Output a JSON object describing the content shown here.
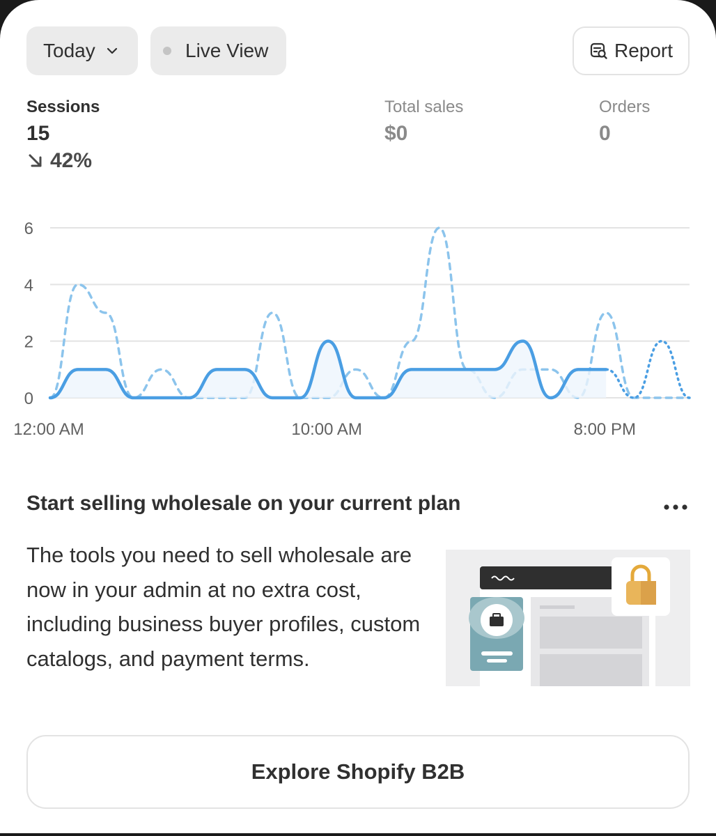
{
  "toolbar": {
    "date_filter_label": "Today",
    "live_view_label": "Live View",
    "report_label": "Report"
  },
  "metrics": {
    "sessions": {
      "label": "Sessions",
      "value": "15",
      "change": "42%"
    },
    "total_sales": {
      "label": "Total sales",
      "value": "$0"
    },
    "orders": {
      "label": "Orders",
      "value": "0"
    }
  },
  "chart_data": {
    "type": "line",
    "title": "",
    "xlabel": "",
    "ylabel": "",
    "ylim": [
      0,
      6
    ],
    "yticks": [
      0,
      2,
      4,
      6
    ],
    "xtick_labels": [
      "12:00 AM",
      "10:00 AM",
      "8:00 PM"
    ],
    "grid": true,
    "series": [
      {
        "style": "solid",
        "color": "#4a9ee3",
        "values": [
          0,
          1,
          1,
          0,
          0,
          0,
          1,
          1,
          0,
          0,
          2,
          0,
          0,
          1,
          1,
          1,
          1,
          2,
          0,
          1,
          1,
          0,
          2,
          0
        ]
      },
      {
        "style": "dashed",
        "color": "#8cc4ec",
        "values": [
          0,
          4,
          3,
          0,
          1,
          0,
          0,
          0,
          3,
          0,
          0,
          1,
          0,
          2,
          6,
          1,
          0,
          1,
          1,
          0,
          3,
          0,
          0,
          0
        ]
      }
    ]
  },
  "promo": {
    "title": "Start selling wholesale on your current plan",
    "body": "The tools you need to sell wholesale are now in your admin at no extra cost, including business buyer profiles, custom catalogs, and payment terms.",
    "cta_label": "Explore Shopify B2B"
  },
  "icons": {
    "chevron": "chevron-down-icon",
    "report": "report-search-icon",
    "trend": "arrow-down-right-icon",
    "more": "more-horizontal-icon"
  }
}
